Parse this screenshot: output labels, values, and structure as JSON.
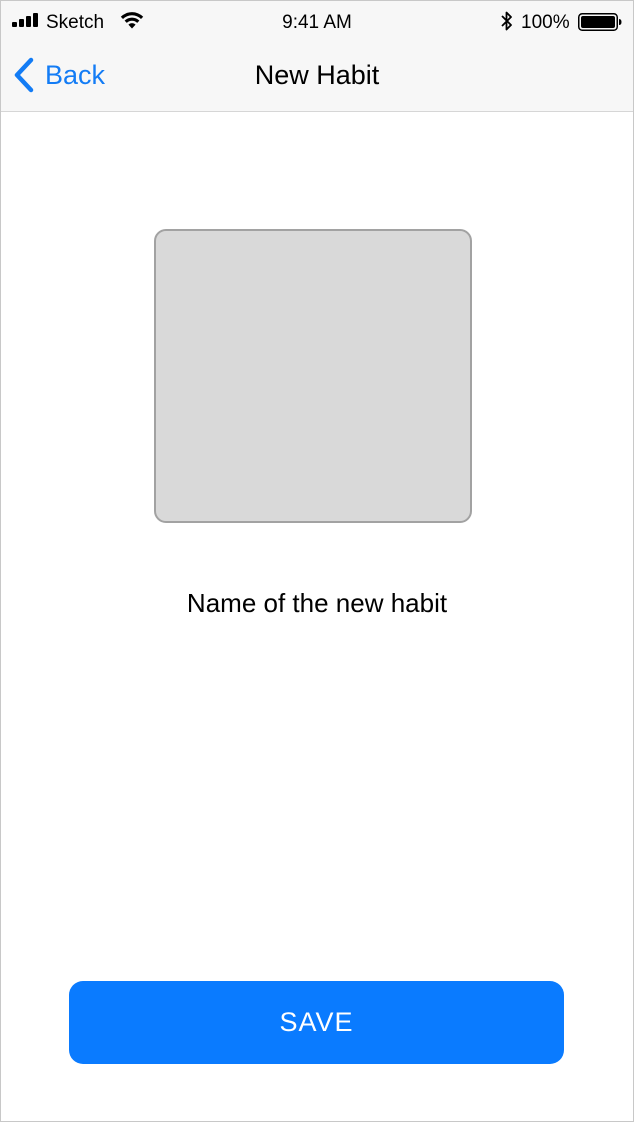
{
  "status_bar": {
    "carrier": "Sketch",
    "time": "9:41 AM",
    "battery_percent": "100%",
    "icons": [
      "signal-icon",
      "wifi-icon",
      "bluetooth-icon",
      "battery-icon"
    ]
  },
  "nav_bar": {
    "back_label": "Back",
    "title": "New Habit",
    "back_icon": "chevron-left-icon"
  },
  "main": {
    "habit_name": "Name of the new habit"
  },
  "footer": {
    "save_label": "SAVE"
  },
  "colors": {
    "accent": "#137cf5",
    "button_background": "#0a7bff",
    "placeholder_fill": "#d9d9d9",
    "placeholder_border": "#a2a2a2",
    "bar_background": "#f7f7f7"
  }
}
